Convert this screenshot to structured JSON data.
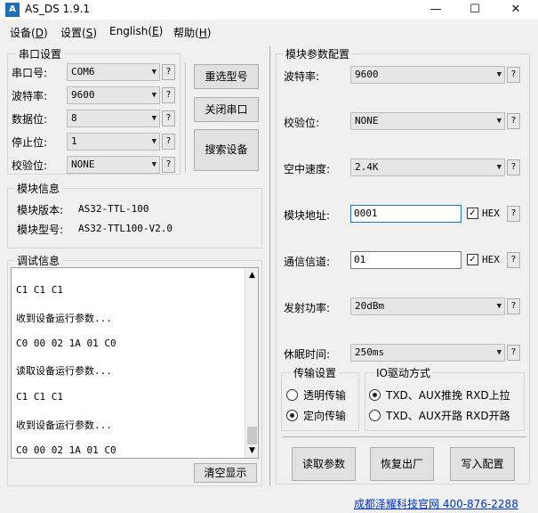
{
  "window": {
    "title": "AS_DS 1.9.1",
    "minimize": "—",
    "maximize": "☐",
    "close": "✕"
  },
  "menu": [
    {
      "label": "设备(",
      "key": "D",
      "end": ")"
    },
    {
      "label": "设置(",
      "key": "S",
      "end": ")"
    },
    {
      "label": "English(",
      "key": "E",
      "end": ")"
    },
    {
      "label": "帮助(",
      "key": "H",
      "end": ")"
    }
  ],
  "serial": {
    "title": "串口设置",
    "port_label": "串口号:",
    "port_value": "COM6",
    "baud_label": "波特率:",
    "baud_value": "9600",
    "data_label": "数据位:",
    "data_value": "8",
    "stop_label": "停止位:",
    "stop_value": "1",
    "parity_label": "校验位:",
    "parity_value": "NONE",
    "help": "?",
    "reselect_button": "重选型号",
    "close_port_button": "关闭串口",
    "search_button": "搜索设备"
  },
  "module_info": {
    "title": "模块信息",
    "version_label": "模块版本:",
    "version_value": "AS32-TTL-100",
    "model_label": "模块型号:",
    "model_value": "AS32-TTL100-V2.0"
  },
  "debug": {
    "title": "调试信息",
    "lines": [
      "C1 C1 C1",
      "收到设备运行参数...",
      "C0 00 02 1A 01 C0",
      "读取设备运行参数...",
      "C1 C1 C1",
      "收到设备运行参数...",
      "C0 00 02 1A 01 C0"
    ],
    "clear_button": "清空显示"
  },
  "params": {
    "title": "模块参数配置",
    "baud_label": "波特率:",
    "baud_value": "9600",
    "parity_label": "校验位:",
    "parity_value": "NONE",
    "air_label": "空中速度:",
    "air_value": "2.4K",
    "addr_label": "模块地址:",
    "addr_value": "0001",
    "channel_label": "通信信道:",
    "channel_value": "01",
    "power_label": "发射功率:",
    "power_value": "20dBm",
    "sleep_label": "休眠时间:",
    "sleep_value": "250ms",
    "hex_label": "HEX",
    "help": "?"
  },
  "transfer": {
    "title": "传输设置",
    "transparent": "透明传输",
    "directed": "定向传输",
    "selected": "定向传输"
  },
  "io_drive": {
    "title": "IO驱动方式",
    "pushpull": "TXD、AUX推挽 RXD上拉",
    "opendrain": "TXD、AUX开路 RXD开路",
    "selected": "TXD、AUX推挽 RXD上拉"
  },
  "actions": {
    "read": "读取参数",
    "restore": "恢复出厂",
    "write": "写入配置"
  },
  "footer": {
    "link": "成都泽耀科技官网 400-876-2288"
  }
}
